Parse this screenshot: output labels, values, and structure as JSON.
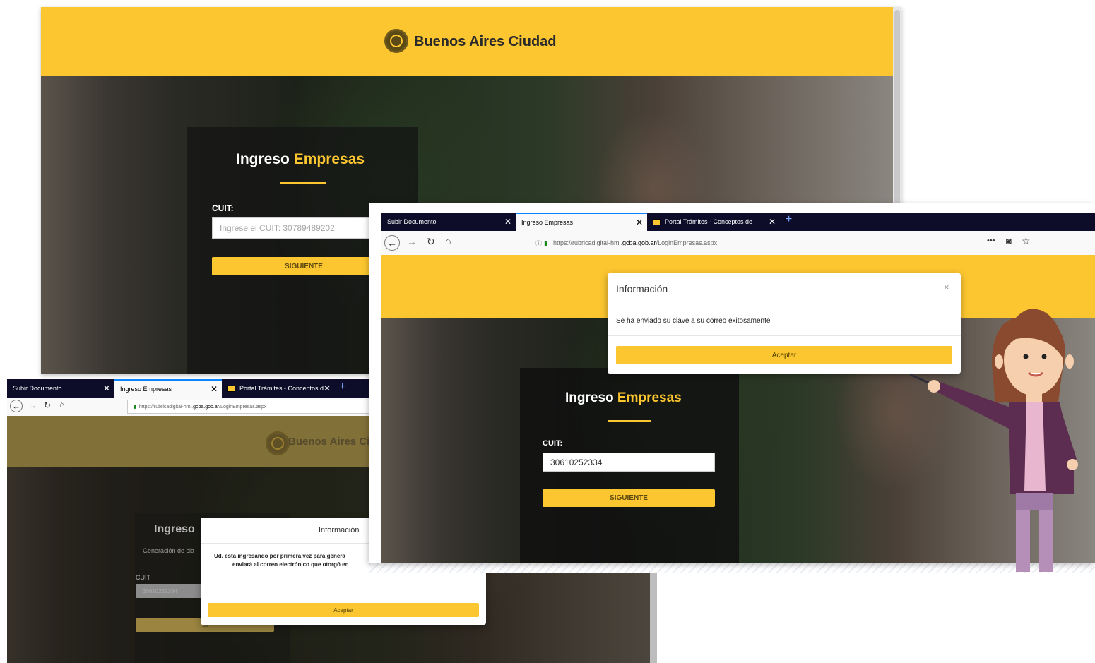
{
  "brand": {
    "name": "Buenos Aires Ciudad",
    "name_partial": "Buenos Aires Ci"
  },
  "login": {
    "title_main": "Ingreso",
    "title_accent": "Empresas",
    "subtitle_partial": "Generación de cla",
    "cuit_label": "CUIT:",
    "cuit_label_plain": "CUIT",
    "cuit_placeholder": "Ingrese el CUIT: 30789489202",
    "cuit_value": "30610252334",
    "next_button": "SIGUIENTE",
    "next_button_partial": "SI"
  },
  "browser": {
    "tabs": [
      {
        "label": "Subir Documento"
      },
      {
        "label": "Ingreso Empresas"
      },
      {
        "label": "Portal Trámites - Conceptos d"
      },
      {
        "label": "Portal Trámites - Conceptos de"
      }
    ],
    "url_prefix": "https://rubricadigital-hml.",
    "url_domain": "gcba.gob.ar",
    "url_path": "/LoginEmpresas.aspx",
    "menu_dots": "•••"
  },
  "modal_front": {
    "title": "Información",
    "message": "Se ha enviado su clave a su correo exitosamente",
    "accept": "Aceptar"
  },
  "modal_bl": {
    "title_partial": "Información",
    "line1": "Ud. esta ingresando por primera vez para genera",
    "line2": "enviará al correo electrónico que otorgó en",
    "accept": "Aceptar"
  },
  "colors": {
    "brand_yellow": "#fcc630",
    "tab_bar": "#0d0d2a",
    "active_tab_accent": "#0a84ff"
  }
}
